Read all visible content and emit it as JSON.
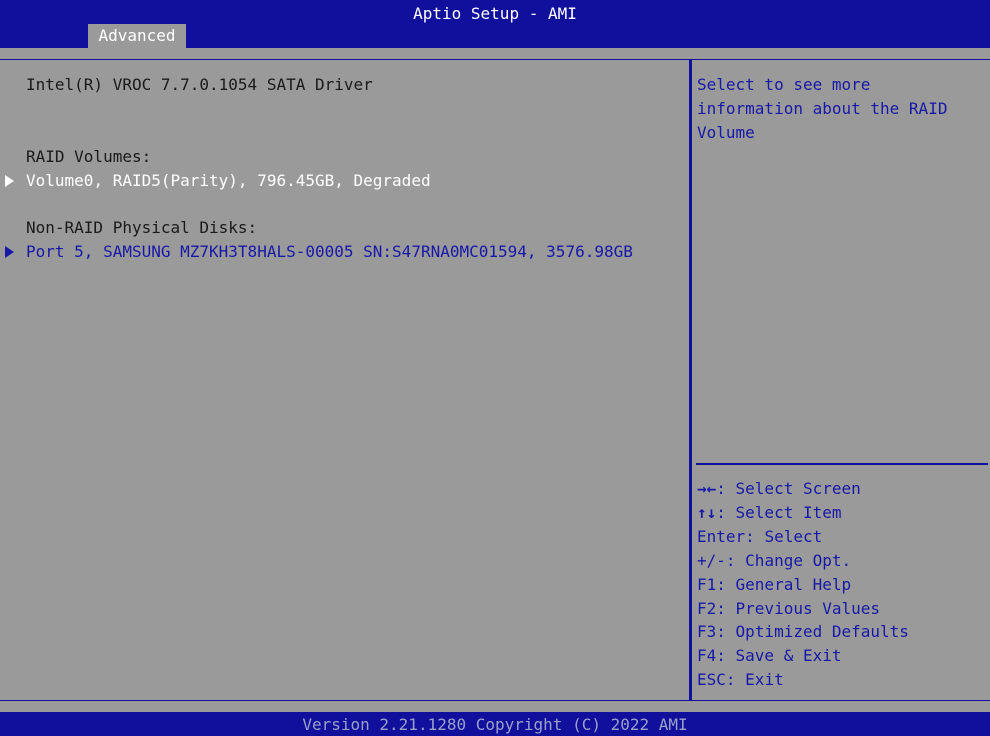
{
  "header": {
    "title": "Aptio Setup - AMI",
    "tabs": [
      {
        "label": "Advanced"
      }
    ]
  },
  "main": {
    "driver_title": "Intel(R) VROC 7.7.0.1054 SATA Driver",
    "raid_volumes_label": "RAID Volumes:",
    "raid_volumes": [
      {
        "label": "Volume0, RAID5(Parity), 796.45GB, Degraded"
      }
    ],
    "non_raid_label": "Non-RAID Physical Disks:",
    "non_raid_disks": [
      {
        "label": "Port 5, SAMSUNG MZ7KH3T8HALS-00005 SN:S47RNA0MC01594, 3576.98GB"
      }
    ]
  },
  "help": {
    "description": [
      "Select to see more",
      "information about the RAID",
      "Volume"
    ],
    "keys": [
      {
        "key": "→←",
        "action": ": Select Screen"
      },
      {
        "key": "↑↓",
        "action": ": Select Item"
      },
      {
        "key": "Enter",
        "action": ": Select"
      },
      {
        "key": "+/-",
        "action": ": Change Opt."
      },
      {
        "key": "F1",
        "action": ": General Help"
      },
      {
        "key": "F2",
        "action": ": Previous Values"
      },
      {
        "key": "F3",
        "action": ": Optimized Defaults"
      },
      {
        "key": "F4",
        "action": ": Save & Exit"
      },
      {
        "key": "ESC",
        "action": ": Exit"
      }
    ]
  },
  "footer": {
    "version": "Version 2.21.1280 Copyright (C) 2022 AMI"
  },
  "colors": {
    "header_bg": "#10109c",
    "panel_bg": "#9a9a9a",
    "highlight_text": "#ffffff",
    "help_text": "#1818a8"
  }
}
